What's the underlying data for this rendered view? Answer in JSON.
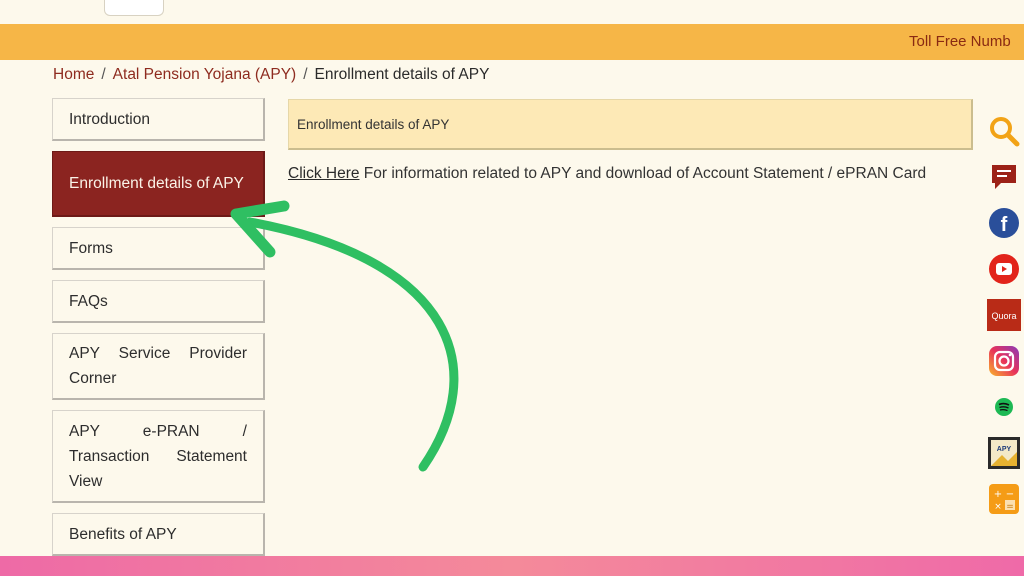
{
  "ticker": {
    "text": "Toll Free Numb"
  },
  "breadcrumb": {
    "home": "Home",
    "separator": "/",
    "parent": "Atal Pension Yojana (APY)",
    "current": "Enrollment details of APY"
  },
  "sidebar": {
    "items": [
      {
        "label": "Introduction",
        "active": false
      },
      {
        "label": "Enrollment details of APY",
        "active": true
      },
      {
        "label": "Forms",
        "active": false
      },
      {
        "label": "FAQs",
        "active": false
      },
      {
        "label": "APY Service Provider Corner",
        "active": false
      },
      {
        "label": "APY e-PRAN / Transaction Statement View",
        "active": false
      },
      {
        "label": "Benefits of APY",
        "active": false
      }
    ]
  },
  "content": {
    "header": "Enrollment details of APY",
    "link_text": "Click Here",
    "body_text": " For information related to APY and download of Account Statement / ePRAN Card"
  },
  "social": {
    "icons": [
      "search-icon",
      "feedback-icon",
      "facebook-icon",
      "youtube-icon",
      "quora-icon",
      "instagram-icon",
      "spotify-icon",
      "apy-app-icon",
      "calculator-icon"
    ],
    "quora_label": "Quora",
    "apy_label": "APY"
  },
  "colors": {
    "ticker": "#f6b647",
    "active_item": "#8b2420",
    "arrow": "#2fbf62",
    "header_bg": "#fde9b6"
  }
}
